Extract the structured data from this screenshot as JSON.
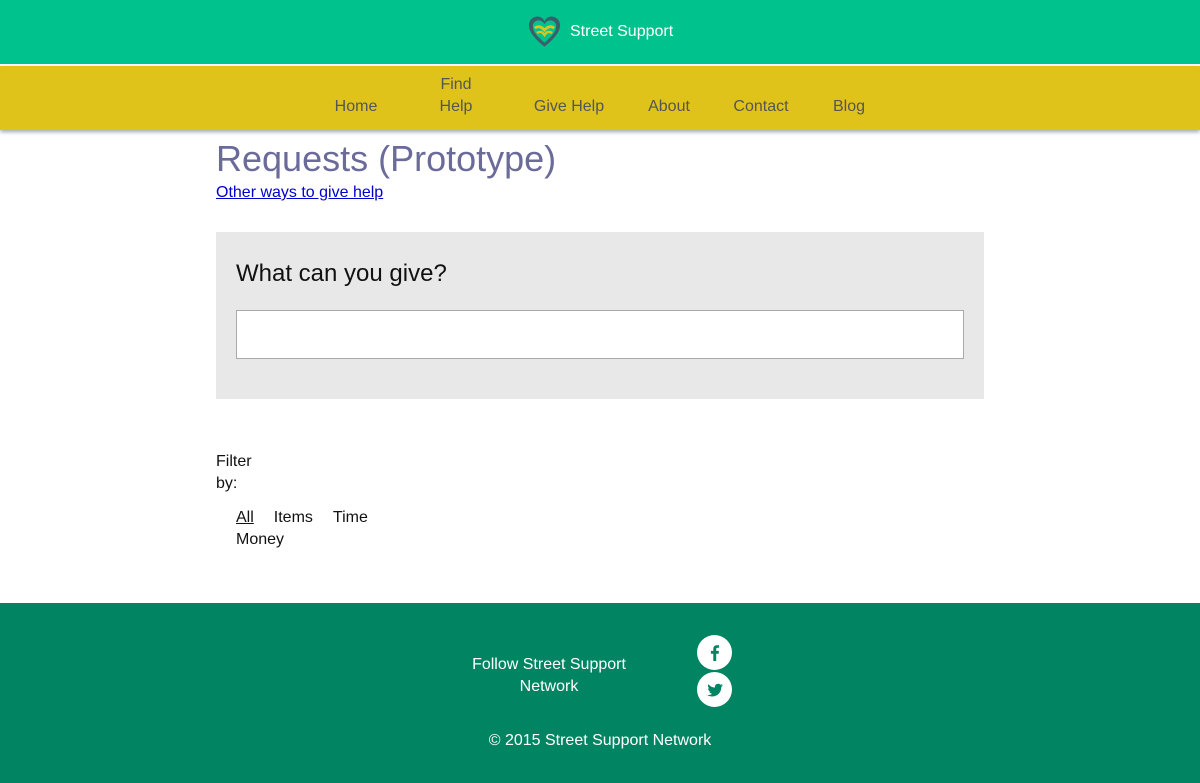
{
  "header": {
    "brand_title": "Street Support",
    "logo_icon": "heart-hands-logo-icon"
  },
  "nav": {
    "items": [
      {
        "label": "Home"
      },
      {
        "label": "Find Help"
      },
      {
        "label": "Give Help"
      },
      {
        "label": "About"
      },
      {
        "label": "Contact"
      },
      {
        "label": "Blog"
      }
    ]
  },
  "main": {
    "title": "Requests (Prototype)",
    "other_ways_link": "Other ways to give help",
    "give_panel": {
      "heading": "What can you give?",
      "input_value": "",
      "input_placeholder": ""
    },
    "filter": {
      "label": "Filter by:",
      "options": [
        "All",
        "Items",
        "Time",
        "Money"
      ],
      "selected": "All"
    }
  },
  "footer": {
    "follow_text": "Follow Street Support Network",
    "social": [
      {
        "icon": "facebook-icon"
      },
      {
        "icon": "twitter-icon"
      }
    ],
    "copyright": "© 2015 Street Support Network"
  },
  "colors": {
    "header_bg": "#00c28c",
    "nav_bg": "#e0c31a",
    "footer_bg": "#008462",
    "title_color": "#6b6b9a",
    "panel_bg": "#e8e8e8"
  }
}
